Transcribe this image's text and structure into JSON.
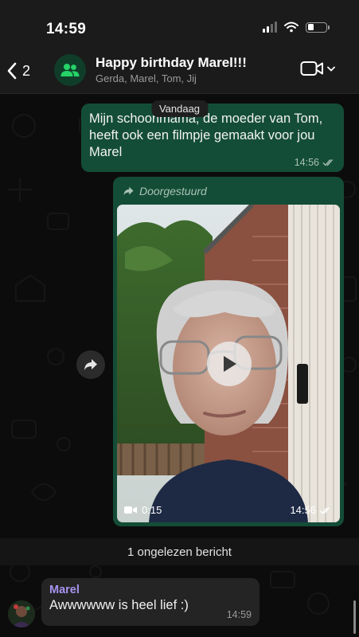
{
  "status_bar": {
    "time": "14:59",
    "battery_level": 0.35
  },
  "header": {
    "back_count": "2",
    "title": "Happy birthday Marel!!!",
    "members": "Gerda, Marel, Tom, Jij"
  },
  "chat": {
    "date_separator": "Vandaag",
    "messages": [
      {
        "direction": "outgoing",
        "text": "Mijn schoonmama, de moeder van Tom, heeft ook een filmpje gemaakt voor jou Marel",
        "time": "14:56",
        "status": "read"
      },
      {
        "direction": "outgoing",
        "forwarded_label": "Doorgestuurd",
        "type": "video",
        "duration": "0:15",
        "time": "14:56",
        "status": "read"
      }
    ],
    "unread_banner": "1 ongelezen bericht",
    "incoming": {
      "sender": "Marel",
      "text": "Awwwwww is heel lief :)",
      "time": "14:59"
    }
  },
  "icons": {
    "back": "chevron-left-icon",
    "group": "group-icon",
    "video_call": "video-camera-icon",
    "forward": "forward-arrow-icon",
    "play": "play-icon",
    "read_receipt": "double-check-icon"
  },
  "colors": {
    "outgoing_bubble": "#144d37",
    "incoming_bubble": "#242424",
    "sender_name": "#a793f0",
    "accent_green": "#25d366"
  }
}
